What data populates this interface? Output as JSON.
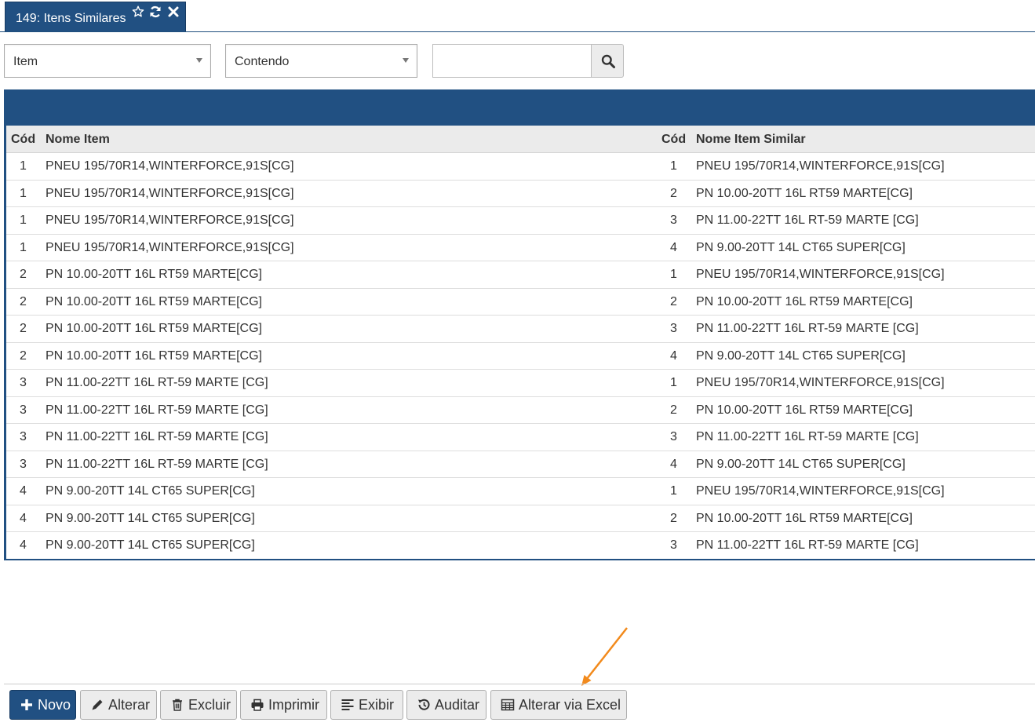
{
  "tab": {
    "title": "149: Itens Similares",
    "icons": [
      "star-icon",
      "refresh-icon",
      "close-icon"
    ]
  },
  "filter": {
    "field_selected": "Item",
    "operator_selected": "Contendo",
    "search_value": "",
    "search_icon": "search-icon"
  },
  "grid": {
    "header_color": "#215082",
    "columns": {
      "code1": "Cód",
      "name1": "Nome Item",
      "code2": "Cód",
      "name2": "Nome Item Similar"
    },
    "rows": [
      {
        "code1": "1",
        "name1": "PNEU 195/70R14,WINTERFORCE,91S[CG]",
        "code2": "1",
        "name2": "PNEU 195/70R14,WINTERFORCE,91S[CG]"
      },
      {
        "code1": "1",
        "name1": "PNEU 195/70R14,WINTERFORCE,91S[CG]",
        "code2": "2",
        "name2": "PN 10.00-20TT 16L RT59 MARTE[CG]"
      },
      {
        "code1": "1",
        "name1": "PNEU 195/70R14,WINTERFORCE,91S[CG]",
        "code2": "3",
        "name2": "PN 11.00-22TT 16L RT-59 MARTE [CG]"
      },
      {
        "code1": "1",
        "name1": "PNEU 195/70R14,WINTERFORCE,91S[CG]",
        "code2": "4",
        "name2": "PN 9.00-20TT 14L CT65 SUPER[CG]"
      },
      {
        "code1": "2",
        "name1": "PN 10.00-20TT 16L RT59 MARTE[CG]",
        "code2": "1",
        "name2": "PNEU 195/70R14,WINTERFORCE,91S[CG]"
      },
      {
        "code1": "2",
        "name1": "PN 10.00-20TT 16L RT59 MARTE[CG]",
        "code2": "2",
        "name2": "PN 10.00-20TT 16L RT59 MARTE[CG]"
      },
      {
        "code1": "2",
        "name1": "PN 10.00-20TT 16L RT59 MARTE[CG]",
        "code2": "3",
        "name2": "PN 11.00-22TT 16L RT-59 MARTE [CG]"
      },
      {
        "code1": "2",
        "name1": "PN 10.00-20TT 16L RT59 MARTE[CG]",
        "code2": "4",
        "name2": "PN 9.00-20TT 14L CT65 SUPER[CG]"
      },
      {
        "code1": "3",
        "name1": "PN 11.00-22TT 16L RT-59 MARTE [CG]",
        "code2": "1",
        "name2": "PNEU 195/70R14,WINTERFORCE,91S[CG]"
      },
      {
        "code1": "3",
        "name1": "PN 11.00-22TT 16L RT-59 MARTE [CG]",
        "code2": "2",
        "name2": "PN 10.00-20TT 16L RT59 MARTE[CG]"
      },
      {
        "code1": "3",
        "name1": "PN 11.00-22TT 16L RT-59 MARTE [CG]",
        "code2": "3",
        "name2": "PN 11.00-22TT 16L RT-59 MARTE [CG]"
      },
      {
        "code1": "3",
        "name1": "PN 11.00-22TT 16L RT-59 MARTE [CG]",
        "code2": "4",
        "name2": "PN 9.00-20TT 14L CT65 SUPER[CG]"
      },
      {
        "code1": "4",
        "name1": "PN 9.00-20TT 14L CT65 SUPER[CG]",
        "code2": "1",
        "name2": "PNEU 195/70R14,WINTERFORCE,91S[CG]"
      },
      {
        "code1": "4",
        "name1": "PN 9.00-20TT 14L CT65 SUPER[CG]",
        "code2": "2",
        "name2": "PN 10.00-20TT 16L RT59 MARTE[CG]"
      },
      {
        "code1": "4",
        "name1": "PN 9.00-20TT 14L CT65 SUPER[CG]",
        "code2": "3",
        "name2": "PN 11.00-22TT 16L RT-59 MARTE [CG]"
      }
    ]
  },
  "annotation": {
    "arrow_color": "#f28a1c",
    "target": "Alterar via Excel"
  },
  "toolbar": {
    "novo": "Novo",
    "alterar": "Alterar",
    "excluir": "Excluir",
    "imprimir": "Imprimir",
    "exibir": "Exibir",
    "auditar": "Auditar",
    "alterar_excel": "Alterar via Excel",
    "primary_color": "#215082"
  }
}
